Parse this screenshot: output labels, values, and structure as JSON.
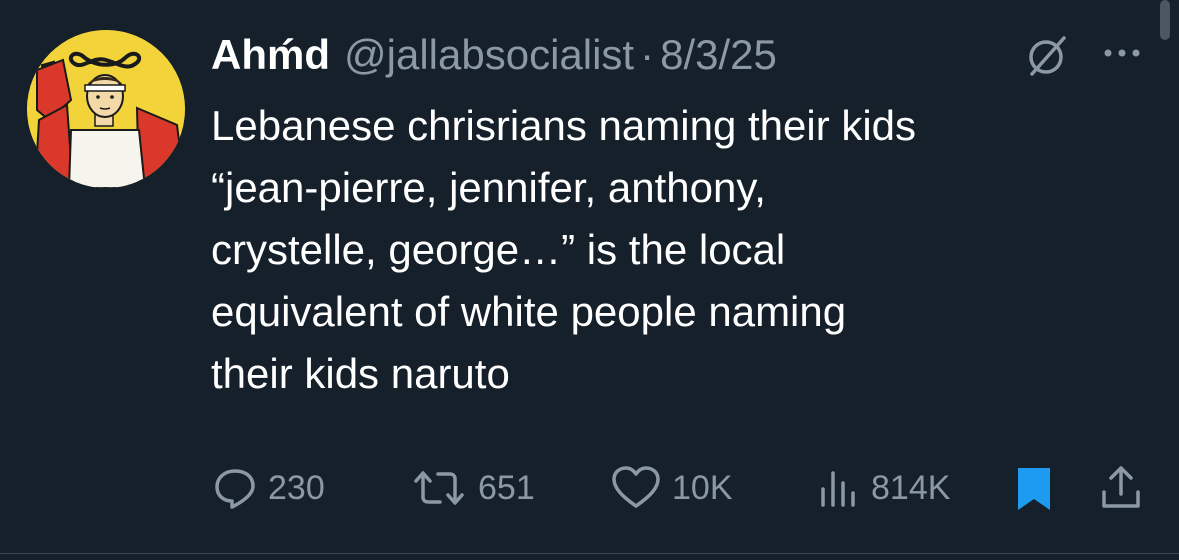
{
  "tweet": {
    "author_name": "Ahḿd",
    "handle": "@jallabsocialist",
    "separator": "·",
    "date": "8/3/25",
    "text_lines": [
      "Lebanese chrisrians naming their kids",
      "“jean-pierre, jennifer, anthony,",
      "crystelle, george…” is the local",
      "equivalent of white people naming",
      "their kids naruto"
    ]
  },
  "actions": {
    "replies": "230",
    "reposts": "651",
    "likes": "10K",
    "views": "814K"
  },
  "colors": {
    "background": "#15202b",
    "text_primary": "#ffffff",
    "text_secondary": "#8b98a5",
    "accent": "#1d9bf0"
  },
  "icons": {
    "grok": "grok-icon",
    "more": "more-icon",
    "reply": "reply-icon",
    "repost": "repost-icon",
    "like": "heart-icon",
    "views": "views-icon",
    "bookmark": "bookmark-icon",
    "share": "share-icon"
  }
}
